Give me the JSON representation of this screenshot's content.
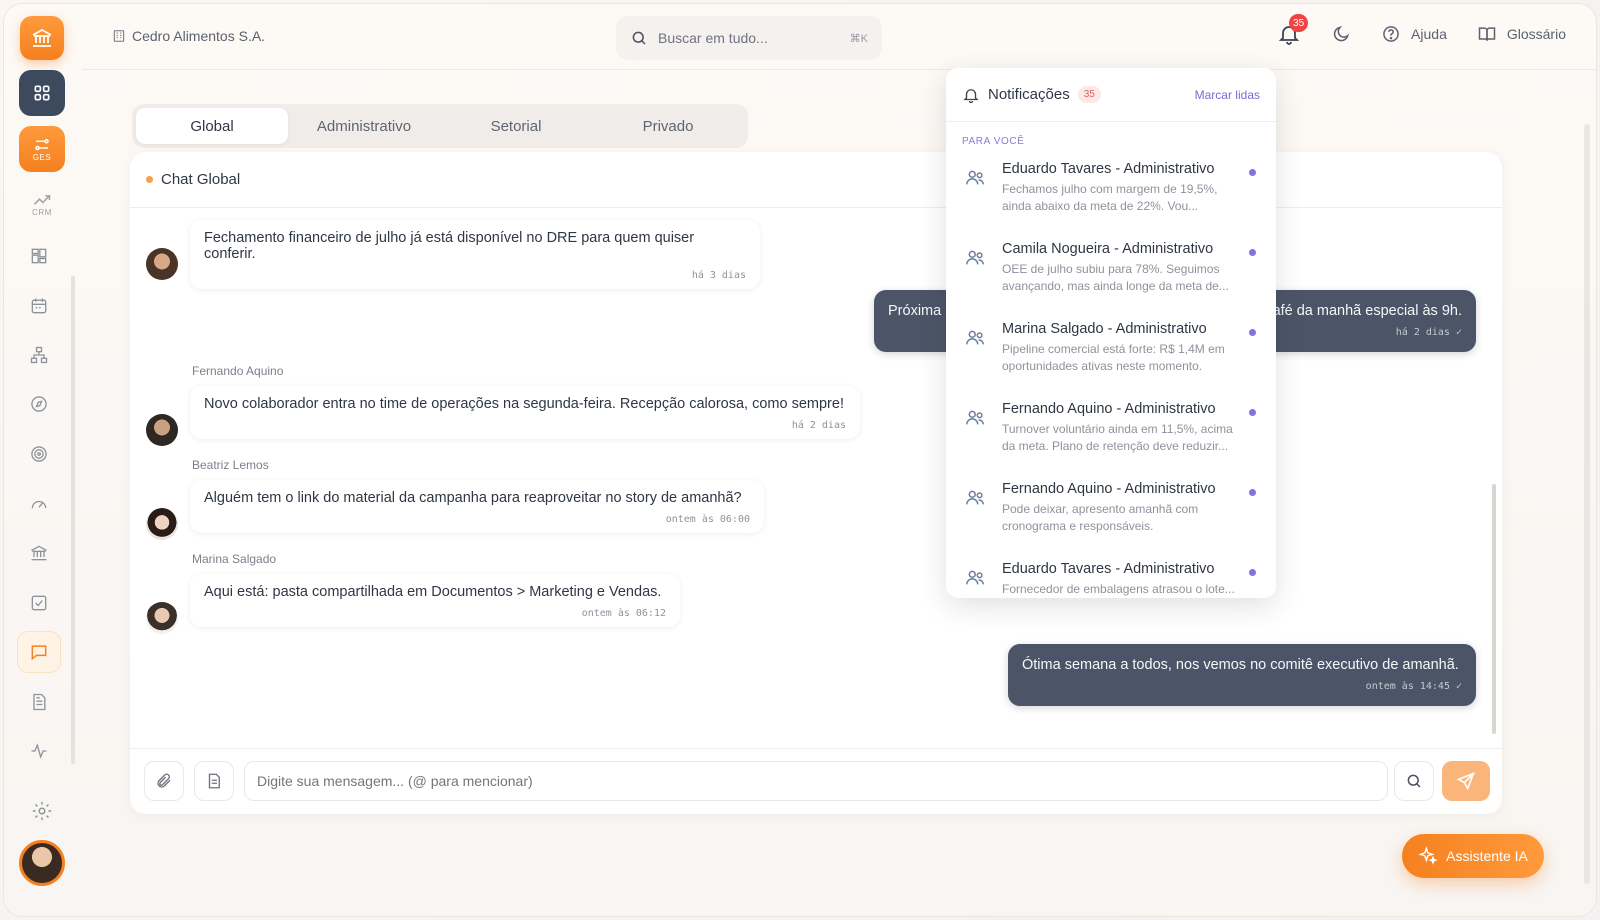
{
  "company": {
    "name": "Cedro Alimentos S.A."
  },
  "search": {
    "placeholder": "Buscar em tudo...",
    "shortcut": "⌘K"
  },
  "topbar": {
    "notif_count": "35",
    "help": "Ajuda",
    "glossary": "Glossário"
  },
  "sidebar": {
    "ges_label": "GES",
    "crm_label": "CRM"
  },
  "tabs": [
    "Global",
    "Administrativo",
    "Setorial",
    "Privado"
  ],
  "chat": {
    "title": "Chat Global",
    "messages": [
      {
        "sender": "",
        "text": "Fechamento financeiro de julho já está disponível no DRE para quem quiser conferir.",
        "time": "há 3 dias"
      },
      {
        "sender": "",
        "text": "Próxima",
        "text_end": "afé da manhã especial às 9h.",
        "time": "há 2 dias ✓"
      },
      {
        "sender": "Fernando Aquino",
        "text": "Novo colaborador entra no time de operações na segunda-feira. Recepção calorosa, como sempre!",
        "time": "há 2 dias"
      },
      {
        "sender": "Beatriz Lemos",
        "text": "Alguém tem o link do material da campanha para reaproveitar no story de amanhã?",
        "time": "ontem às 06:00"
      },
      {
        "sender": "Marina Salgado",
        "text": "Aqui está: pasta compartilhada em Documentos > Marketing e Vendas.",
        "time": "ontem às 06:12"
      },
      {
        "sender": "",
        "text": "Ótima semana a todos, nos vemos no comitê executivo de amanhã.",
        "time": "ontem às 14:45 ✓"
      }
    ],
    "input_placeholder": "Digite sua mensagem... (@ para mencionar)"
  },
  "notifications": {
    "title": "Notificações",
    "count": "35",
    "mark_read": "Marcar lidas",
    "section": "PARA VOCÊ",
    "items": [
      {
        "title": "Eduardo Tavares - Administrativo",
        "body": "Fechamos julho com margem de 19,5%, ainda abaixo da meta de 22%. Vou..."
      },
      {
        "title": "Camila Nogueira - Administrativo",
        "body": "OEE de julho subiu para 78%. Seguimos avançando, mas ainda longe da meta de..."
      },
      {
        "title": "Marina Salgado - Administrativo",
        "body": "Pipeline comercial está forte: R$ 1,4M em oportunidades ativas neste momento."
      },
      {
        "title": "Fernando Aquino - Administrativo",
        "body": "Turnover voluntário ainda em 11,5%, acima da meta. Plano de retenção deve reduzir..."
      },
      {
        "title": "Fernando Aquino - Administrativo",
        "body": "Pode deixar, apresento amanhã com cronograma e responsáveis."
      },
      {
        "title": "Eduardo Tavares - Administrativo",
        "body": "Fornecedor de embalagens atrasou o lote..."
      }
    ]
  },
  "assistant": {
    "label": "Assistente IA"
  },
  "colors": {
    "accent": "#f5801f",
    "dark": "#3d4a5e",
    "purple": "#8b6ee0"
  }
}
